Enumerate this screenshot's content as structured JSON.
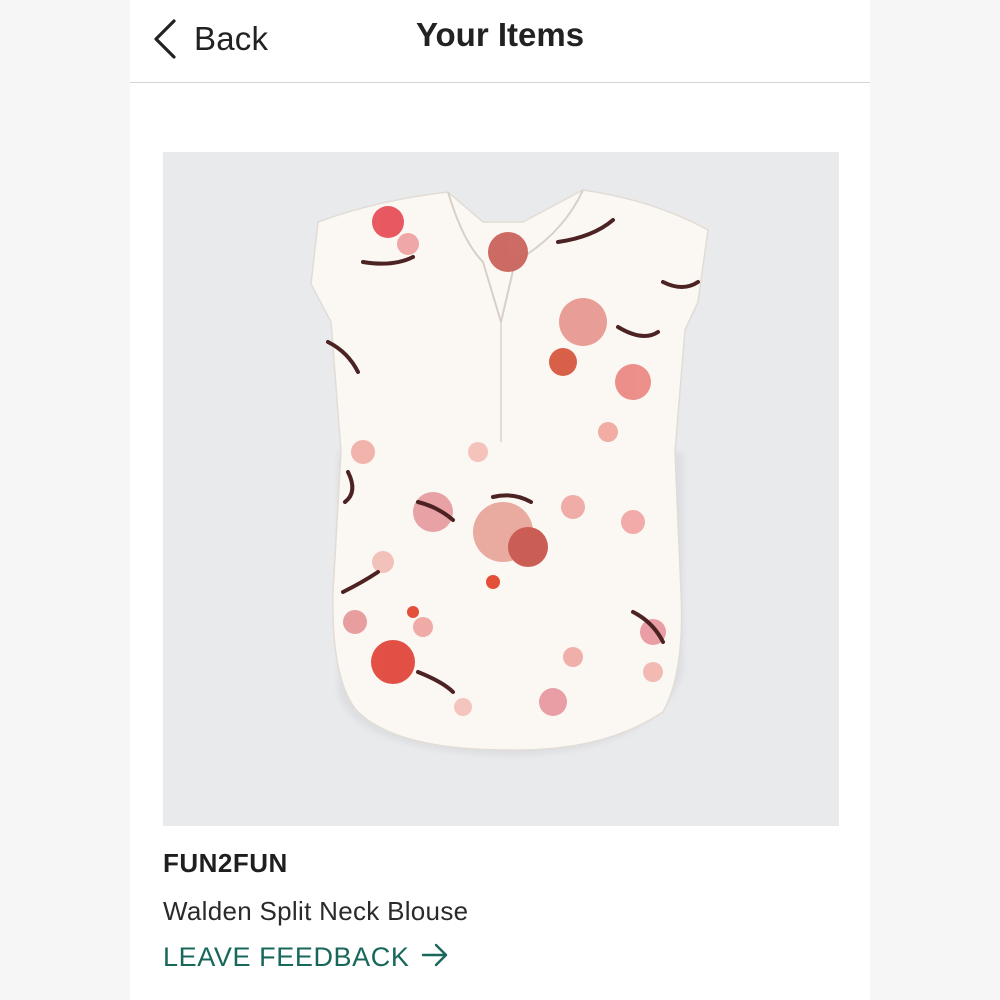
{
  "header": {
    "back_label": "Back",
    "title": "Your Items"
  },
  "item": {
    "image_icon": "floral-blouse-image",
    "brand": "FUN2FUN",
    "name": "Walden Split Neck Blouse",
    "feedback_label": "LEAVE FEEDBACK"
  },
  "colors": {
    "accent": "#17685a",
    "image_background": "#e9eaec",
    "divider": "#d4d4d4"
  }
}
